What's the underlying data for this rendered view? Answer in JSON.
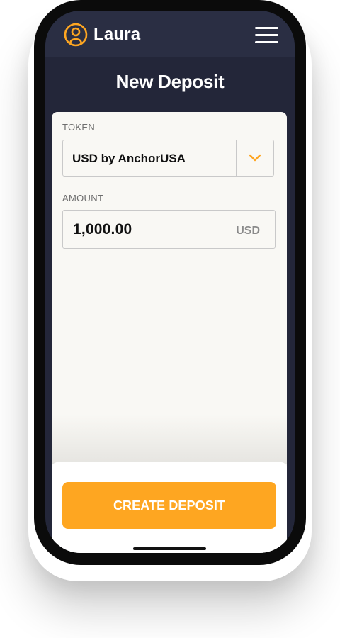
{
  "header": {
    "username": "Laura",
    "user_icon": "user-circle-icon",
    "menu_icon": "hamburger-menu-icon"
  },
  "page": {
    "title": "New Deposit"
  },
  "form": {
    "token": {
      "label": "TOKEN",
      "value": "USD by AnchorUSA",
      "icon": "chevron-down-icon"
    },
    "amount": {
      "label": "AMOUNT",
      "value": "1,000.00",
      "unit": "USD"
    }
  },
  "actions": {
    "create_deposit": "CREATE DEPOSIT"
  },
  "colors": {
    "accent": "#fea621",
    "header_bg": "#2a2e43",
    "screen_bg": "#232639",
    "card_bg": "#f9f8f4"
  }
}
